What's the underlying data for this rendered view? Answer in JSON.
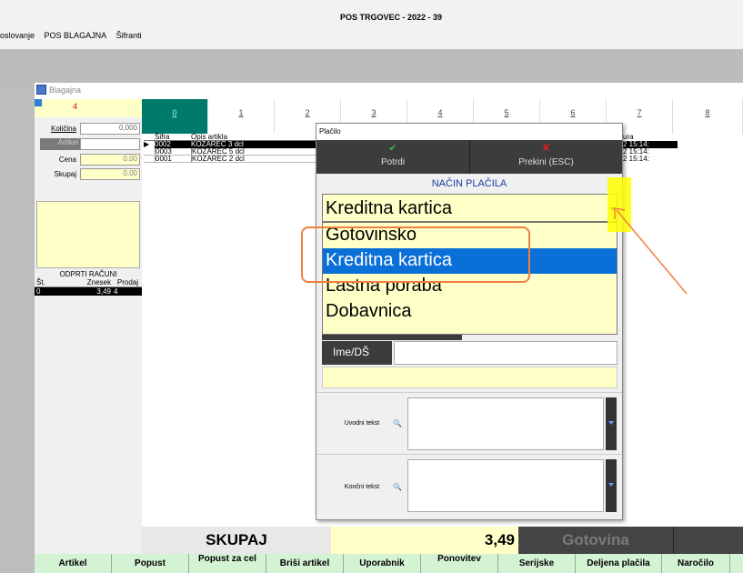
{
  "app": {
    "title": "POS TRGOVEC - 2022 - 39"
  },
  "menu": {
    "items": [
      "oslovanje",
      "POS BLAGAJNA",
      "Šifranti"
    ]
  },
  "window": {
    "title": "Blagajna"
  },
  "left": {
    "counter": "4",
    "kolicina_label": "Količina",
    "kolicina_value": "0,000",
    "artikel_label": "Artikel",
    "cena_label": "Cena",
    "cena_value": "0,00",
    "skupaj_label": "Skupaj",
    "skupaj_value": "0,00",
    "odprti_title": "ODPRTI RAČUNI",
    "odprti_headers": [
      "Št.",
      "Znesek",
      "Prodaj"
    ],
    "odprti_row": [
      "0",
      "3,49",
      "4"
    ]
  },
  "tabs": [
    "0",
    "1",
    "2",
    "3",
    "4",
    "5",
    "6",
    "7",
    "8"
  ],
  "table": {
    "headers": [
      "Šifra",
      "Opis artikla",
      "ura"
    ],
    "rows": [
      {
        "sifra": "0002",
        "opis": "KOZAREC 3 dcl",
        "ura": "2 15:14:"
      },
      {
        "sifra": "0003",
        "opis": "KOZAREC 5 dcl",
        "ura": "2 15:14:"
      },
      {
        "sifra": "0001",
        "opis": "KOZAREC 2 dcl",
        "ura": "2 15:14:"
      }
    ]
  },
  "totals": {
    "skupaj_label": "SKUPAJ",
    "skupaj_value": "3,49",
    "gotovina_label": "Gotovina"
  },
  "buttons": [
    "Artikel",
    "Popust",
    "Popust za cel",
    "Briši artikel",
    "Uporabnik",
    "Ponovitev",
    "Serijske",
    "Deljena plačila",
    "Naročilo"
  ],
  "dialog": {
    "title": "Plačilo",
    "potrdi": "Potrdi",
    "prekini": "Prekini (ESC)",
    "nacin_label": "NAČIN PLAČILA",
    "selected": "Kreditna kartica",
    "options": [
      "Gotovinsko",
      "Kreditna kartica",
      "Lastna poraba",
      "Dobavnica"
    ],
    "ime_label": "Ime/DŠ",
    "uvodni_label": "Uvodni tekst",
    "koncni_label": "Končni tekst"
  },
  "colors": {
    "accent": "#0a6fd6",
    "highlight": "#f08040",
    "field": "#ffffc8",
    "tab_active": "#007a6a"
  }
}
